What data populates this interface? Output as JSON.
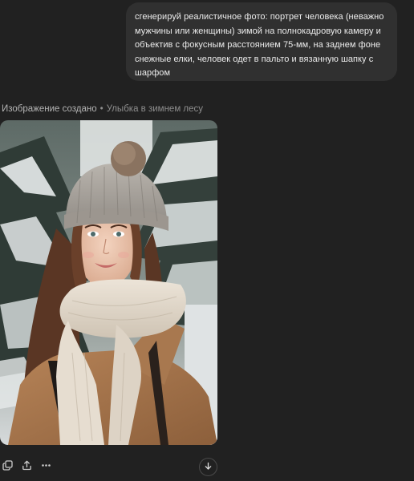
{
  "user_message": {
    "text": "сгенерируй реалистичное фото: портрет человека (неважно мужчины или женщины) зимой на полнокадровую камеру и объектив с фокусным расстоянием 75-мм, на заднем фоне снежные елки, человек одет в пальто и вязанную шапку с шарфом"
  },
  "assistant": {
    "status": "Изображение создано",
    "separator": "•",
    "image_title": "Улыбка в зимнем лесу"
  },
  "actions": {
    "icons": [
      "copy-icon",
      "share-icon",
      "more-icon"
    ]
  },
  "scroll_button": {
    "icon": "arrow-down-icon"
  },
  "colors": {
    "background": "#212121",
    "bubble": "#303030",
    "text": "#ececec",
    "muted": "#8e8e8e"
  }
}
